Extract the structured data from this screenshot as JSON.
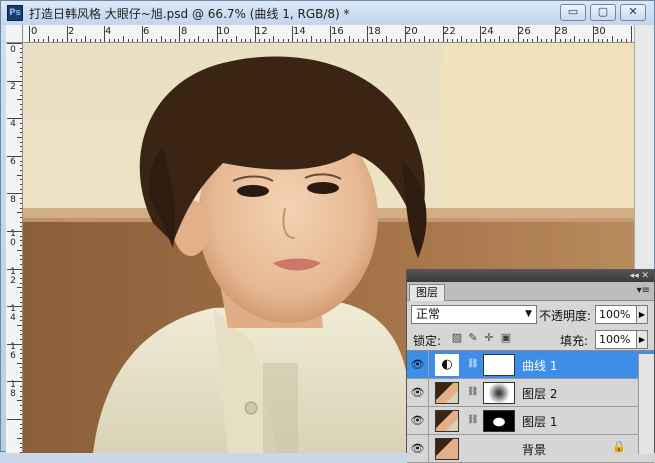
{
  "window": {
    "app_icon": "Ps",
    "title": "打造日韩风格 大眼仔~旭.psd @ 66.7% (曲线 1, RGB/8) *",
    "minimize": "▭",
    "restore": "▢",
    "close": "✕"
  },
  "ruler": {
    "top_labels": [
      "0",
      "2",
      "4",
      "6",
      "8",
      "10",
      "12",
      "14",
      "16",
      "18",
      "20",
      "22",
      "24",
      "26",
      "28",
      "30"
    ],
    "left_labels": [
      "0",
      "2",
      "4",
      "6",
      "8",
      "1\n0",
      "1\n2",
      "1\n4",
      "1\n6",
      "1\n8"
    ]
  },
  "layers_panel": {
    "collapse_icon": "◂◂ ✕",
    "tab_label": "图层",
    "menu_icon": "▾≡",
    "blend_mode": "正常",
    "opacity_label": "不透明度:",
    "opacity_value": "100%",
    "lock_label": "锁定:",
    "fill_label": "填充:",
    "fill_value": "100%",
    "layers": [
      {
        "name": "曲线 1",
        "kind": "adjustment",
        "active": true
      },
      {
        "name": "图层 2",
        "kind": "pixel-mask",
        "active": false
      },
      {
        "name": "图层 1",
        "kind": "pixel-mask",
        "active": false
      },
      {
        "name": "背景",
        "kind": "background",
        "active": false
      }
    ]
  },
  "colors": {
    "active_layer": "#3d8ee6",
    "panel_bg": "#d6d6d6",
    "title_bar": "#c2d5ec"
  }
}
